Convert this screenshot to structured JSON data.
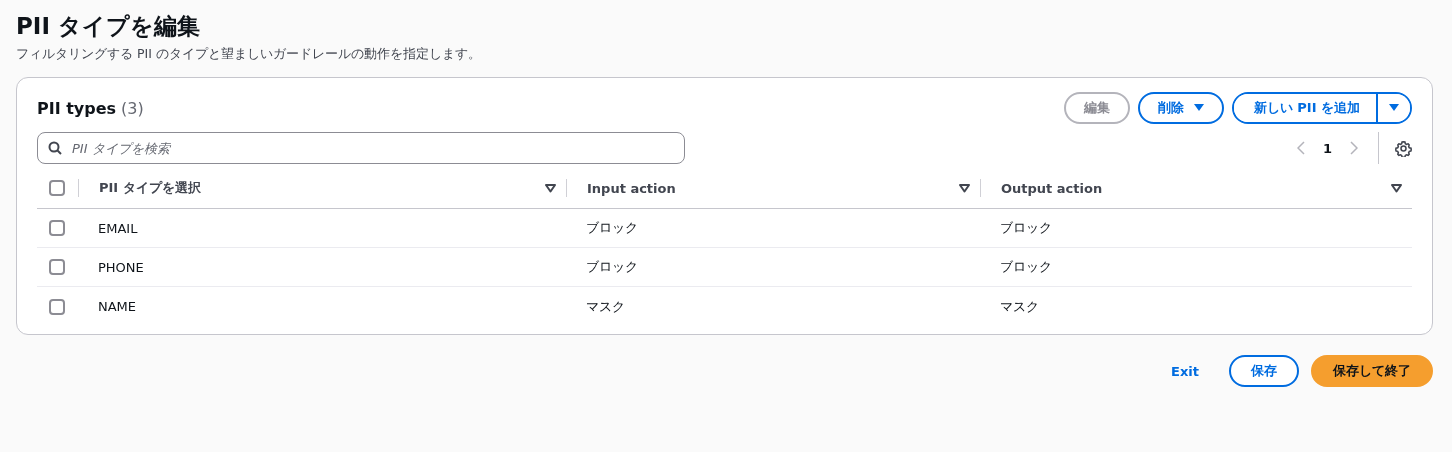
{
  "page": {
    "title": "PII タイプを編集",
    "description": "フィルタリングする PII のタイプと望ましいガードレールの動作を指定します。"
  },
  "panel": {
    "title": "PII types",
    "count": "(3)",
    "actions": [
      {
        "kind": "plain",
        "label": "編集",
        "disabled": true
      },
      {
        "kind": "dropdown",
        "label": "削除",
        "disabled": false
      },
      {
        "kind": "split",
        "label": "新しい PII を追加",
        "disabled": false
      }
    ],
    "search": {
      "placeholder": "PII タイプを検索"
    },
    "pagination": {
      "page": "1",
      "prev_disabled": true,
      "next_disabled": true
    },
    "table": {
      "all_checked": false,
      "columns": [
        "PII タイプを選択",
        "Input action",
        "Output action"
      ],
      "rows": [
        {
          "cells": [
            "EMAIL",
            "ブロック",
            "ブロック"
          ],
          "selected": false
        },
        {
          "cells": [
            "PHONE",
            "ブロック",
            "ブロック"
          ],
          "selected": false
        },
        {
          "cells": [
            "NAME",
            "マスク",
            "マスク"
          ],
          "selected": false
        }
      ]
    }
  },
  "footer": [
    {
      "kind": "link",
      "label": "Exit"
    },
    {
      "kind": "secondary",
      "label": "保存"
    },
    {
      "kind": "primary",
      "label": "保存して終了"
    }
  ]
}
